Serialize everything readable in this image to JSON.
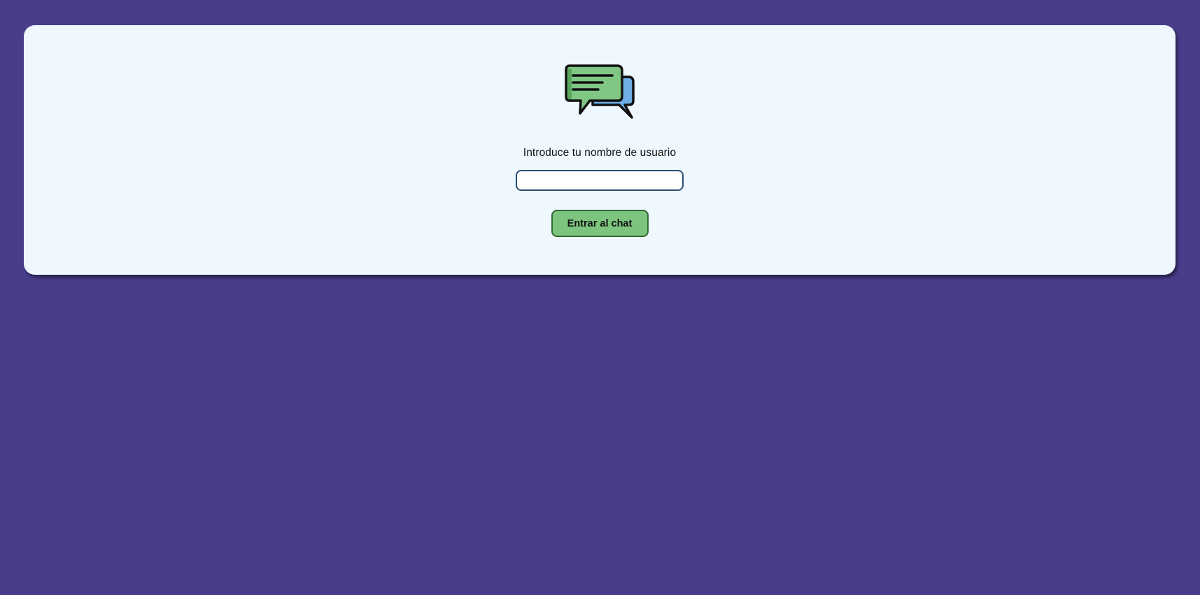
{
  "login": {
    "icon": "chat-bubbles-icon",
    "prompt": "Introduce tu nombre de usuario",
    "username_value": "",
    "enter_label": "Entrar al chat"
  },
  "colors": {
    "background": "#483d8b",
    "card": "#eff7ff",
    "button": "#7dc47f",
    "bubble_green": "#7dc47f",
    "bubble_blue": "#6fb0e8"
  }
}
